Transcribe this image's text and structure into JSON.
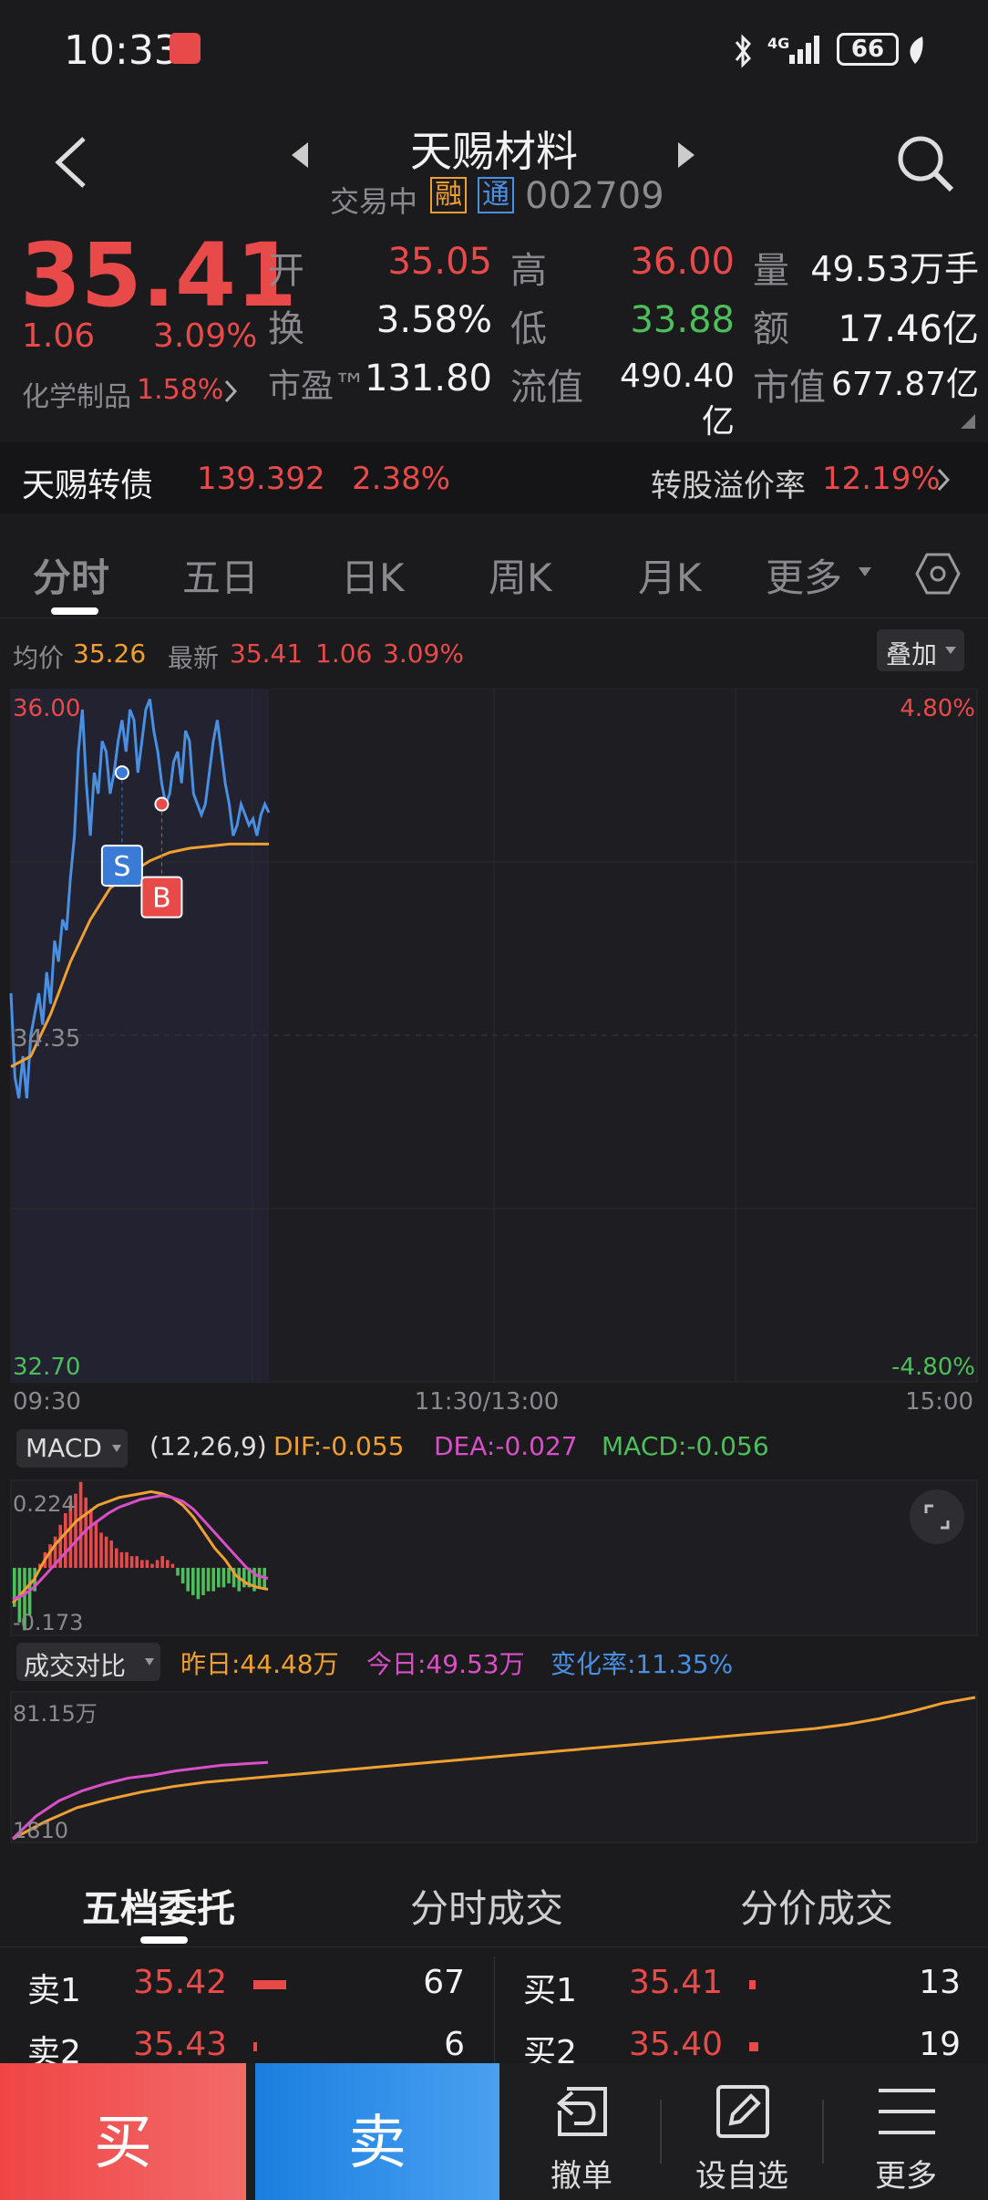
{
  "status": {
    "time": "10:33",
    "network": "4G",
    "battery": "66"
  },
  "header": {
    "title": "天赐材料",
    "status": "交易中",
    "badge_rong": "融",
    "badge_tong": "通",
    "code": "002709"
  },
  "quote": {
    "price": "35.41",
    "change": "1.06",
    "change_pct": "3.09%",
    "sector": "化学制品",
    "sector_pct": "1.58%",
    "fields": [
      {
        "label": "开",
        "value": "35.05",
        "color": "#e84a4a"
      },
      {
        "label": "高",
        "value": "36.00",
        "color": "#e84a4a"
      },
      {
        "label": "量",
        "value": "49.53万手",
        "color": "#f2f2f2"
      },
      {
        "label": "换",
        "value": "3.58%",
        "color": "#f2f2f2"
      },
      {
        "label": "低",
        "value": "33.88",
        "color": "#4cbf5a"
      },
      {
        "label": "额",
        "value": "17.46亿",
        "color": "#f2f2f2"
      },
      {
        "label": "市盈™",
        "value": "131.80",
        "color": "#f2f2f2"
      },
      {
        "label": "流值",
        "value": "490.40亿",
        "color": "#f2f2f2"
      },
      {
        "label": "市值",
        "value": "677.87亿",
        "color": "#f2f2f2"
      }
    ]
  },
  "convertible_bond": {
    "name": "天赐转债",
    "price": "139.392",
    "pct": "2.38%",
    "premium_label": "转股溢价率",
    "premium": "12.19%"
  },
  "tabs": [
    "分时",
    "五日",
    "日K",
    "周K",
    "月K",
    "更多"
  ],
  "chart_info": {
    "avg_label": "均价",
    "avg": "35.26",
    "latest_label": "最新",
    "latest": "35.41",
    "change": "1.06",
    "pct": "3.09%",
    "overlay_button": "叠加"
  },
  "chart_data": [
    {
      "type": "line",
      "title": "分时",
      "y_left_ticks": [
        "36.00",
        "34.35",
        "32.70"
      ],
      "y_right_ticks": [
        "4.80%",
        "-4.80%"
      ],
      "x_ticks": [
        "09:30",
        "11:30/13:00",
        "15:00"
      ],
      "ylim": [
        32.7,
        36.0
      ],
      "markers": [
        {
          "label": "S",
          "price": 35.6
        },
        {
          "label": "B",
          "price": 35.45
        }
      ],
      "series": [
        {
          "name": "最新",
          "color": "#4a90e2",
          "x": [
            0,
            1,
            2,
            3,
            4,
            5,
            6,
            7,
            8,
            9,
            10,
            11,
            12,
            13,
            14,
            15,
            16,
            17,
            18,
            19,
            20,
            21,
            22,
            23,
            24,
            25,
            26,
            27,
            28,
            29,
            30,
            31,
            32,
            33,
            34,
            35,
            36,
            37,
            38,
            39,
            40,
            41,
            42,
            43,
            44,
            45,
            46,
            47,
            48,
            49,
            50,
            51,
            52,
            53,
            54,
            55,
            56,
            57,
            58,
            59,
            60,
            61,
            62,
            63,
            64,
            65
          ],
          "values": [
            34.55,
            34.15,
            34.05,
            34.25,
            34.05,
            34.35,
            34.45,
            34.55,
            34.4,
            34.65,
            34.5,
            34.8,
            34.7,
            34.9,
            34.85,
            35.1,
            35.3,
            35.7,
            35.9,
            35.55,
            35.3,
            35.6,
            35.5,
            35.75,
            35.7,
            35.5,
            35.6,
            35.75,
            35.85,
            35.7,
            35.9,
            35.85,
            35.6,
            35.75,
            35.9,
            35.95,
            35.8,
            35.7,
            35.55,
            35.45,
            35.5,
            35.65,
            35.7,
            35.55,
            35.8,
            35.75,
            35.5,
            35.45,
            35.4,
            35.45,
            35.6,
            35.75,
            35.85,
            35.7,
            35.55,
            35.45,
            35.3,
            35.35,
            35.45,
            35.4,
            35.35,
            35.38,
            35.3,
            35.4,
            35.45,
            35.41
          ]
        },
        {
          "name": "均价",
          "color": "#f0a032",
          "x": [
            0,
            5,
            10,
            15,
            20,
            25,
            30,
            35,
            40,
            45,
            50,
            55,
            60,
            65
          ],
          "values": [
            34.2,
            34.25,
            34.45,
            34.7,
            34.9,
            35.05,
            35.12,
            35.18,
            35.22,
            35.24,
            35.25,
            35.26,
            35.26,
            35.26
          ]
        }
      ]
    },
    {
      "type": "bar",
      "title": "MACD",
      "params": "(12,26,9)",
      "labels": {
        "dif": "DIF:-0.055",
        "dea": "DEA:-0.027",
        "macd": "MACD:-0.056"
      },
      "y_ticks": [
        "0.224",
        "-0.173"
      ],
      "ylim": [
        -0.173,
        0.224
      ],
      "values": [
        -0.1,
        -0.14,
        -0.16,
        -0.12,
        -0.06,
        0.01,
        0.04,
        0.06,
        0.08,
        0.11,
        0.14,
        0.17,
        0.19,
        0.22,
        0.18,
        0.15,
        0.12,
        0.09,
        0.08,
        0.07,
        0.05,
        0.04,
        0.04,
        0.03,
        0.03,
        0.02,
        0.02,
        0.01,
        0.02,
        0.03,
        0.02,
        0.01,
        -0.02,
        -0.04,
        -0.06,
        -0.07,
        -0.08,
        -0.07,
        -0.06,
        -0.06,
        -0.05,
        -0.05,
        -0.04,
        -0.05,
        -0.06,
        -0.05,
        -0.05,
        -0.06,
        -0.05,
        -0.056
      ],
      "series": [
        {
          "name": "DIF",
          "color": "#f0a032",
          "values": [
            -0.09,
            -0.06,
            -0.03,
            0.02,
            0.06,
            0.09,
            0.12,
            0.14,
            0.16,
            0.17,
            0.18,
            0.185,
            0.19,
            0.195,
            0.19,
            0.18,
            0.16,
            0.13,
            0.09,
            0.05,
            0.02,
            -0.02,
            -0.04,
            -0.05,
            -0.055
          ]
        },
        {
          "name": "DEA",
          "color": "#d94fc7",
          "values": [
            -0.08,
            -0.07,
            -0.05,
            -0.02,
            0.01,
            0.04,
            0.07,
            0.1,
            0.12,
            0.14,
            0.155,
            0.165,
            0.175,
            0.18,
            0.185,
            0.18,
            0.17,
            0.15,
            0.12,
            0.09,
            0.06,
            0.03,
            0.0,
            -0.02,
            -0.027
          ]
        }
      ]
    },
    {
      "type": "line",
      "title": "成交对比",
      "labels": {
        "yesterday": "昨日:44.48万",
        "today": "今日:49.53万",
        "rate": "变化率:11.35%"
      },
      "y_ticks": [
        "81.15万",
        "1810"
      ],
      "series": [
        {
          "name": "昨日",
          "color": "#f0a032",
          "values": [
            0.0,
            0.12,
            0.22,
            0.28,
            0.33,
            0.37,
            0.4,
            0.42,
            0.44,
            0.46,
            0.48,
            0.5,
            0.52,
            0.54,
            0.56,
            0.58,
            0.6,
            0.62,
            0.64,
            0.66,
            0.68,
            0.7,
            0.72,
            0.74,
            0.76,
            0.78,
            0.81,
            0.85,
            0.9,
            0.96,
            1.0
          ]
        },
        {
          "name": "今日",
          "color": "#d94fc7",
          "values": [
            0.0,
            0.16,
            0.27,
            0.34,
            0.39,
            0.43,
            0.45,
            0.48,
            0.5,
            0.52,
            0.53,
            0.54
          ]
        }
      ]
    }
  ],
  "order_tabs": [
    "五档委托",
    "分时成交",
    "分价成交"
  ],
  "orders": {
    "sell": [
      {
        "label": "卖1",
        "price": "35.42",
        "vol": "67",
        "bar": 0.6
      },
      {
        "label": "卖2",
        "price": "35.43",
        "vol": "6",
        "bar": 0.06
      }
    ],
    "buy": [
      {
        "label": "买1",
        "price": "35.41",
        "vol": "13",
        "bar": 0.12
      },
      {
        "label": "买2",
        "price": "35.40",
        "vol": "19",
        "bar": 0.17
      }
    ]
  },
  "bottom": {
    "buy": "买",
    "sell": "卖",
    "cancel": "撤单",
    "watchlist": "设自选",
    "more": "更多"
  }
}
